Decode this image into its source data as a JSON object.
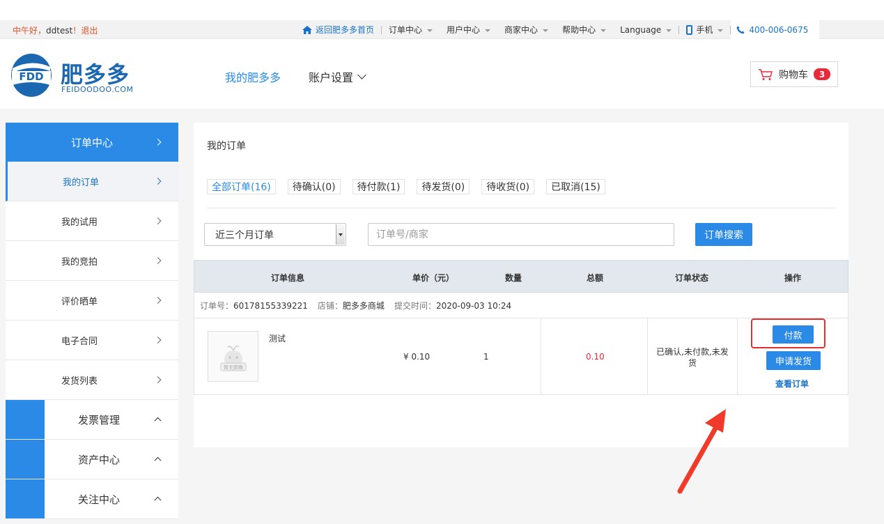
{
  "topbar": {
    "greeting": "中午好，",
    "username": "ddtest",
    "exclaim": "！",
    "logout": "退出",
    "home_link": "返回肥多多首页",
    "order_center": "订单中心",
    "user_center": "用户中心",
    "merchant_center": "商家中心",
    "help_center": "帮助中心",
    "language": "Language",
    "mobile": "手机",
    "phone": "400-006-0675"
  },
  "header": {
    "logo_mark": "FDD",
    "logo_cn": "肥多多",
    "logo_en": "FEIDOODOO.COM",
    "nav_my": "我的肥多多",
    "nav_account": "账户设置",
    "cart_label": "购物车",
    "cart_count": "3"
  },
  "sidebar": {
    "head": "订单中心",
    "items": [
      {
        "label": "我的订单"
      },
      {
        "label": "我的试用"
      },
      {
        "label": "我的竞拍"
      },
      {
        "label": "评价晒单"
      },
      {
        "label": "电子合同"
      },
      {
        "label": "发货列表"
      }
    ],
    "groups": [
      {
        "label": "发票管理"
      },
      {
        "label": "资产中心"
      },
      {
        "label": "关注中心"
      }
    ]
  },
  "main": {
    "title": "我的订单",
    "tabs": [
      {
        "label": "全部订单(16)"
      },
      {
        "label": "待确认(0)"
      },
      {
        "label": "待付款(1)"
      },
      {
        "label": "待发货(0)"
      },
      {
        "label": "待收货(0)"
      },
      {
        "label": "已取消(15)"
      }
    ],
    "filter_selected": "近三个月订单",
    "search_placeholder": "订单号/商家",
    "search_button": "订单搜索",
    "columns": [
      "订单信息",
      "单价（元）",
      "数量",
      "总额",
      "订单状态",
      "操作"
    ],
    "order": {
      "order_no_label": "订单号：",
      "order_no": "60178155339221",
      "shop_label": "店铺：",
      "shop": "肥多多商城",
      "time_label": "提交时间：",
      "time": "2020-09-03 10:24",
      "thumb_text": "暂无图像",
      "product_name": "测试",
      "unit_price": "¥ 0.10",
      "quantity": "1",
      "total": "0.10",
      "status": "已确认,未付款,未发货",
      "pay_button": "付款",
      "ship_button": "申请发货",
      "view_link": "查看订单"
    }
  },
  "colors": {
    "accent": "#2a8ae6",
    "danger": "#e8293a",
    "brand": "#1b67b0"
  }
}
